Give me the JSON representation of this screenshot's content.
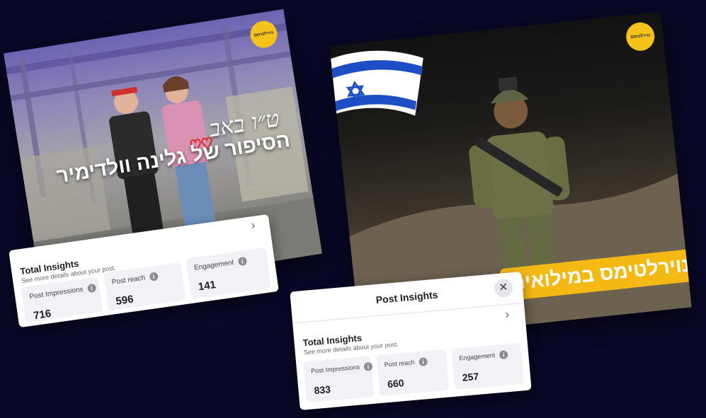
{
  "photo_left": {
    "logo_text": "נוירלטימס",
    "title_small": "ט״ו באב",
    "title_main": "הסיפור של גלינה וולדימיר"
  },
  "photo_right": {
    "logo_text": "נוירלטימס",
    "banner_text": "נוירלטימס במילואים"
  },
  "panel_left": {
    "total_label": "Total Insights",
    "subtitle": "See more details about your post.",
    "chevron": "›",
    "metrics": [
      {
        "label": "Post Impressions",
        "value": "716"
      },
      {
        "label": "Post reach",
        "value": "596"
      },
      {
        "label": "Engagement",
        "value": "141"
      }
    ]
  },
  "panel_right": {
    "title": "Post Insights",
    "close": "✕",
    "total_label": "Total Insights",
    "subtitle": "See more details about your post.",
    "chevron": "›",
    "metrics": [
      {
        "label": "Post Impressions",
        "value": "833"
      },
      {
        "label": "Post reach",
        "value": "660"
      },
      {
        "label": "Engagement",
        "value": "257"
      }
    ]
  },
  "colors": {
    "background": "#090826",
    "logo": "#f3c21b",
    "banner": "#f5b914",
    "flag_blue": "#1d4fc4"
  }
}
